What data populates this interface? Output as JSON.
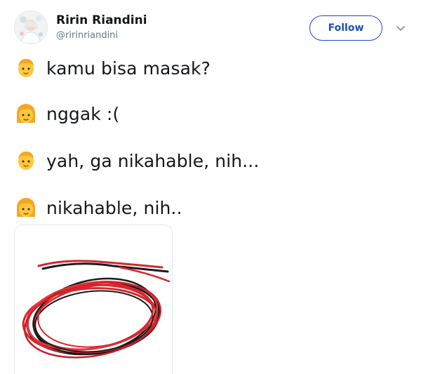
{
  "author": {
    "name": "Ririn Riandini",
    "handle": "@ririnriandini",
    "avatar_icon": "avatar-icon"
  },
  "actions": {
    "follow_label": "Follow",
    "more_icon": "chevron-down-icon"
  },
  "dialogue": [
    {
      "speaker": "man",
      "emoji_icon": "man-emoji-icon",
      "text": "kamu bisa masak?"
    },
    {
      "speaker": "woman",
      "emoji_icon": "woman-emoji-icon",
      "text": "nggak :("
    },
    {
      "speaker": "man",
      "emoji_icon": "man-emoji-icon",
      "text": "yah, ga nikahable, nih..."
    },
    {
      "speaker": "woman",
      "emoji_icon": "woman-emoji-icon",
      "text": "nikahable, nih.."
    }
  ],
  "media": {
    "image_icon": "red-black-cable-coil-image"
  },
  "colors": {
    "accent": "#1c4fb8",
    "name": "#14171a",
    "handle": "#657786",
    "cable_red": "#d8262e",
    "cable_black": "#1a1a1a"
  }
}
